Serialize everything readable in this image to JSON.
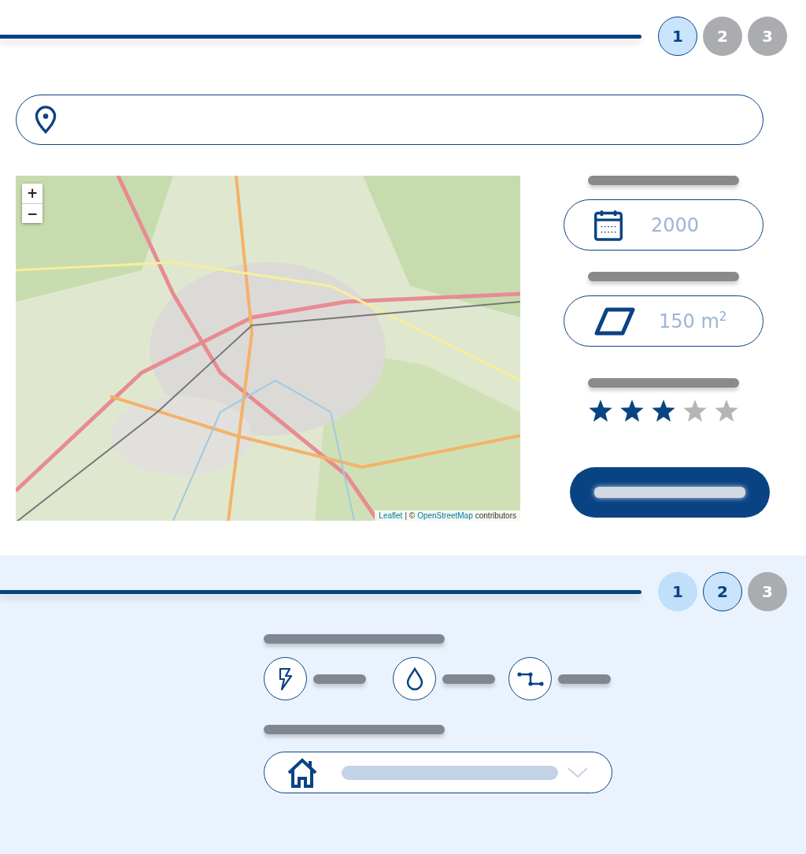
{
  "location_step": {
    "steps": [
      {
        "label": "1",
        "selected": true,
        "completed": false
      },
      {
        "label": "2",
        "selected": false,
        "completed": false
      },
      {
        "label": "3",
        "selected": false,
        "completed": false
      }
    ],
    "map": {
      "kind": "picture",
      "zoom_in": "+",
      "zoom_out": "−",
      "attribution": {
        "leaflet": "Leaflet",
        "separator": "| ©",
        "osm": "OpenStreetMap",
        "suffix": "contributors"
      }
    },
    "year_field": {
      "placeholder": "2000"
    },
    "area_field": {
      "placeholder": "150 m$^{2}$"
    },
    "rating": {
      "stars": 3
    }
  },
  "utilities_step": {
    "steps": [
      {
        "label": "1",
        "selected": false,
        "completed": true
      },
      {
        "label": "2",
        "selected": true,
        "completed": false
      },
      {
        "label": "3",
        "selected": false,
        "completed": false
      }
    ],
    "utilities": [
      {
        "kind": "electricity"
      },
      {
        "kind": "water"
      },
      {
        "kind": "pipe"
      }
    ]
  }
}
